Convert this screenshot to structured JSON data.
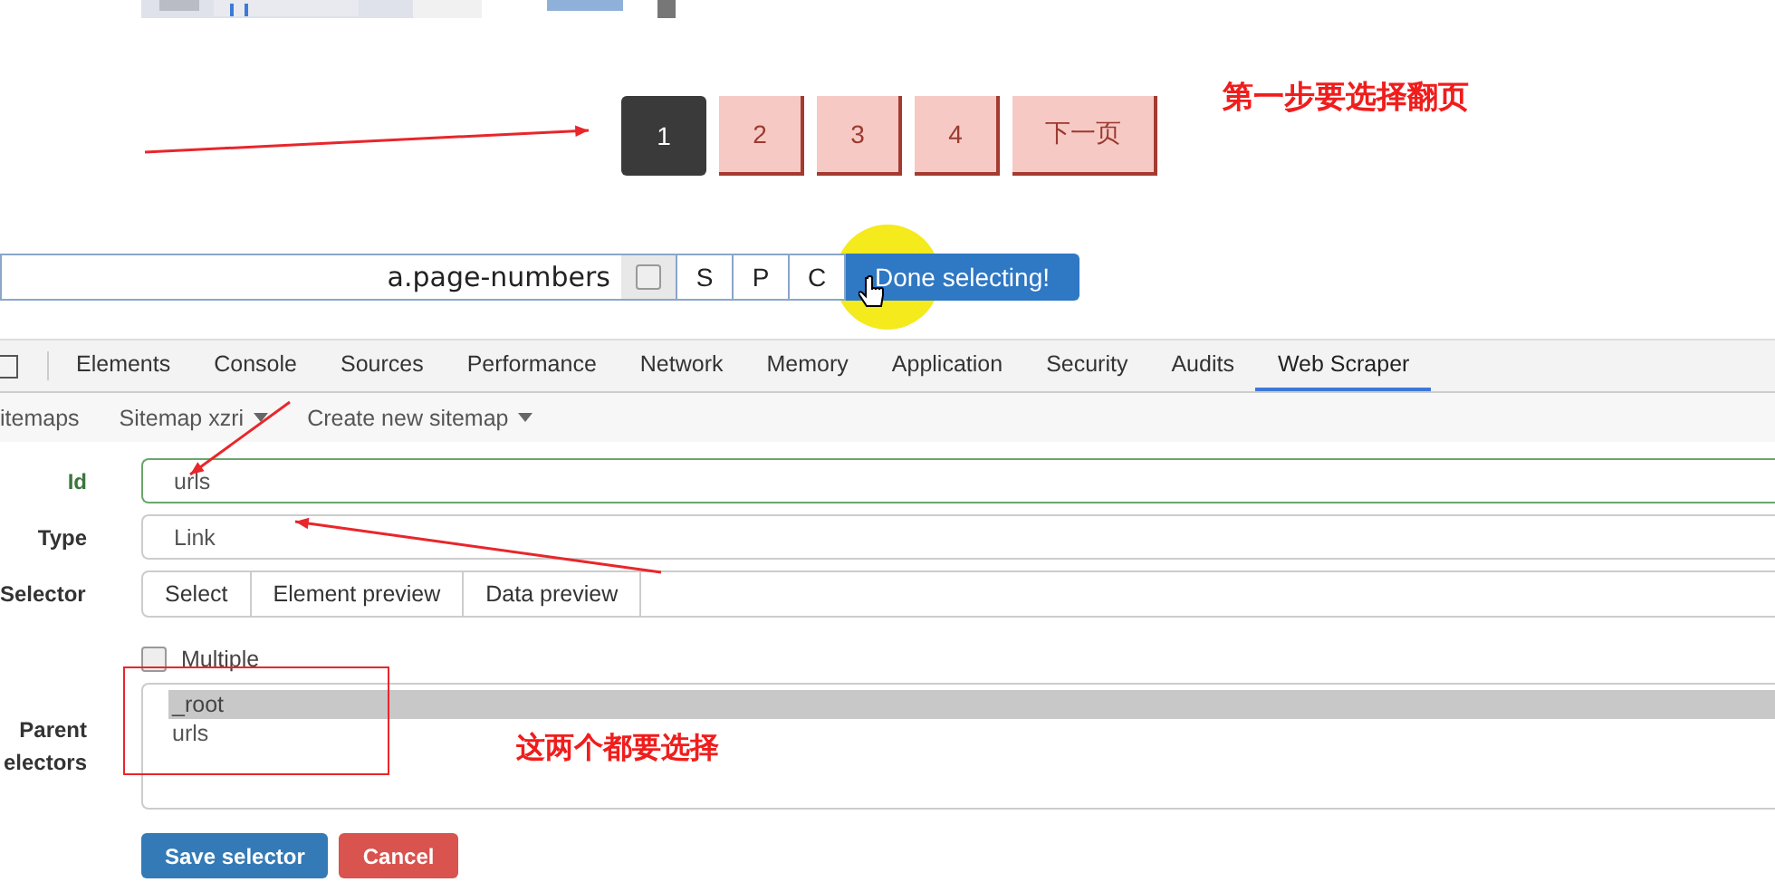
{
  "pagination": [
    {
      "label": "1",
      "selected": true
    },
    {
      "label": "2",
      "selected": false
    },
    {
      "label": "3",
      "selected": false
    },
    {
      "label": "4",
      "selected": false
    },
    {
      "label": "下一页",
      "selected": false
    }
  ],
  "annotations": [
    {
      "text": "第一步要选择翻页"
    },
    {
      "text": "这两个都要选择"
    }
  ],
  "selector_bar": {
    "value": "a.page-numbers",
    "checked": false,
    "keys": [
      "S",
      "P",
      "C"
    ],
    "done_button": "Done selecting!"
  },
  "devtools_tabs": [
    {
      "label": "Elements",
      "selected": false
    },
    {
      "label": "Console",
      "selected": false
    },
    {
      "label": "Sources",
      "selected": false
    },
    {
      "label": "Performance",
      "selected": false
    },
    {
      "label": "Network",
      "selected": false
    },
    {
      "label": "Memory",
      "selected": false
    },
    {
      "label": "Application",
      "selected": false
    },
    {
      "label": "Security",
      "selected": false
    },
    {
      "label": "Audits",
      "selected": false
    },
    {
      "label": "Web Scraper",
      "selected": true
    }
  ],
  "sub_nav": [
    {
      "label": "itemaps",
      "dropdown": false
    },
    {
      "label": "Sitemap xzri",
      "dropdown": true
    },
    {
      "label": "Create new sitemap",
      "dropdown": true
    }
  ],
  "form": {
    "id": {
      "label": "Id",
      "value": "urls",
      "valid": true
    },
    "type": {
      "label": "Type",
      "value": "Link"
    },
    "selector": {
      "label": "Selector",
      "buttons": [
        "Select",
        "Element preview",
        "Data preview"
      ]
    },
    "multiple": {
      "label": "Multiple",
      "checked": false
    },
    "parent_selectors": {
      "label": "Parent electors",
      "options": [
        {
          "label": "_root",
          "selected": true
        },
        {
          "label": "urls",
          "selected": false
        }
      ]
    },
    "buttons": [
      {
        "label": "Save selector",
        "kind": "primary"
      },
      {
        "label": "Cancel",
        "kind": "danger"
      }
    ]
  }
}
